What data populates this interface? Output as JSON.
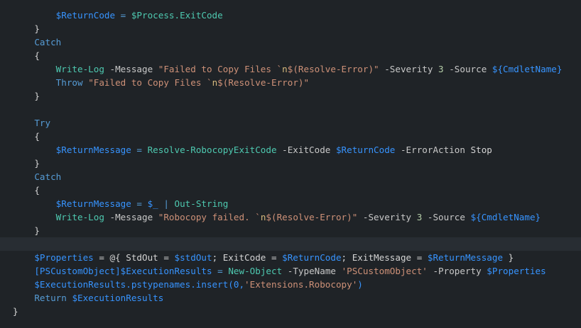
{
  "editor": {
    "lines": [
      [
        {
          "t": "        "
        },
        {
          "t": "$ReturnCode",
          "c": "var"
        },
        {
          "t": " = ",
          "c": "op"
        },
        {
          "t": "$Process.ExitCode",
          "c": "cmd"
        }
      ],
      [
        {
          "t": "    }"
        }
      ],
      [
        {
          "t": "    "
        },
        {
          "t": "Catch",
          "c": "kw"
        }
      ],
      [
        {
          "t": "    {"
        }
      ],
      [
        {
          "t": "        "
        },
        {
          "t": "Write-Log",
          "c": "cmd"
        },
        {
          "t": " -Message ",
          "c": "param"
        },
        {
          "t": "\"Failed to Copy Files `",
          "c": "str"
        },
        {
          "t": "n",
          "c": "esc"
        },
        {
          "t": "$(Resolve-Error)\"",
          "c": "str"
        },
        {
          "t": " -Severity ",
          "c": "param"
        },
        {
          "t": "3",
          "c": "num"
        },
        {
          "t": " -Source ",
          "c": "param"
        },
        {
          "t": "${CmdletName}",
          "c": "var"
        }
      ],
      [
        {
          "t": "        "
        },
        {
          "t": "Throw",
          "c": "kw"
        },
        {
          "t": " "
        },
        {
          "t": "\"Failed to Copy Files `",
          "c": "str"
        },
        {
          "t": "n",
          "c": "esc"
        },
        {
          "t": "$(Resolve-Error)\"",
          "c": "str"
        }
      ],
      [
        {
          "t": "    }"
        }
      ],
      [
        {
          "t": ""
        }
      ],
      [
        {
          "t": "    "
        },
        {
          "t": "Try",
          "c": "kw"
        }
      ],
      [
        {
          "t": "    {"
        }
      ],
      [
        {
          "t": "        "
        },
        {
          "t": "$ReturnMessage",
          "c": "var"
        },
        {
          "t": " = ",
          "c": "op"
        },
        {
          "t": "Resolve-RobocopyExitCode",
          "c": "cmd"
        },
        {
          "t": " -ExitCode ",
          "c": "param"
        },
        {
          "t": "$ReturnCode",
          "c": "var"
        },
        {
          "t": " -ErrorAction ",
          "c": "param"
        },
        {
          "t": "Stop",
          "c": "plain"
        }
      ],
      [
        {
          "t": "    }"
        }
      ],
      [
        {
          "t": "    "
        },
        {
          "t": "Catch",
          "c": "kw"
        }
      ],
      [
        {
          "t": "    {"
        }
      ],
      [
        {
          "t": "        "
        },
        {
          "t": "$ReturnMessage",
          "c": "var"
        },
        {
          "t": " = ",
          "c": "op"
        },
        {
          "t": "$_",
          "c": "var"
        },
        {
          "t": " | ",
          "c": "op"
        },
        {
          "t": "Out-String",
          "c": "cmd"
        }
      ],
      [
        {
          "t": "        "
        },
        {
          "t": "Write-Log",
          "c": "cmd"
        },
        {
          "t": " -Message ",
          "c": "param"
        },
        {
          "t": "\"Robocopy failed. `",
          "c": "str"
        },
        {
          "t": "n",
          "c": "esc"
        },
        {
          "t": "$(Resolve-Error)\"",
          "c": "str"
        },
        {
          "t": " -Severity ",
          "c": "param"
        },
        {
          "t": "3",
          "c": "num"
        },
        {
          "t": " -Source ",
          "c": "param"
        },
        {
          "t": "${CmdletName}",
          "c": "var"
        }
      ],
      [
        {
          "t": "    }"
        }
      ],
      [
        {
          "t": ""
        }
      ],
      [
        {
          "t": "    "
        },
        {
          "t": "$Properties",
          "c": "var"
        },
        {
          "t": " = @{ StdOut = ",
          "c": "plain"
        },
        {
          "t": "$stdOut",
          "c": "var"
        },
        {
          "t": "; ExitCode = ",
          "c": "plain"
        },
        {
          "t": "$ReturnCode",
          "c": "var"
        },
        {
          "t": "; ExitMessage = ",
          "c": "plain"
        },
        {
          "t": "$ReturnMessage",
          "c": "var"
        },
        {
          "t": " }",
          "c": "plain"
        }
      ],
      [
        {
          "t": "    "
        },
        {
          "t": "[PSCustomObject]",
          "c": "var"
        },
        {
          "t": "$ExecutionResults",
          "c": "var"
        },
        {
          "t": " = ",
          "c": "op"
        },
        {
          "t": "New-Object",
          "c": "cmd"
        },
        {
          "t": " -TypeName ",
          "c": "param"
        },
        {
          "t": "'PSCustomObject'",
          "c": "str"
        },
        {
          "t": " -Property ",
          "c": "param"
        },
        {
          "t": "$Properties",
          "c": "var"
        }
      ],
      [
        {
          "t": "    "
        },
        {
          "t": "$ExecutionResults.pstypenames.insert(0,",
          "c": "var"
        },
        {
          "t": "'Extensions.Robocopy'",
          "c": "str"
        },
        {
          "t": ")",
          "c": "var"
        }
      ],
      [
        {
          "t": "    "
        },
        {
          "t": "Return",
          "c": "kw"
        },
        {
          "t": " "
        },
        {
          "t": "$ExecutionResults",
          "c": "var"
        }
      ],
      [
        {
          "t": "}"
        }
      ]
    ]
  }
}
